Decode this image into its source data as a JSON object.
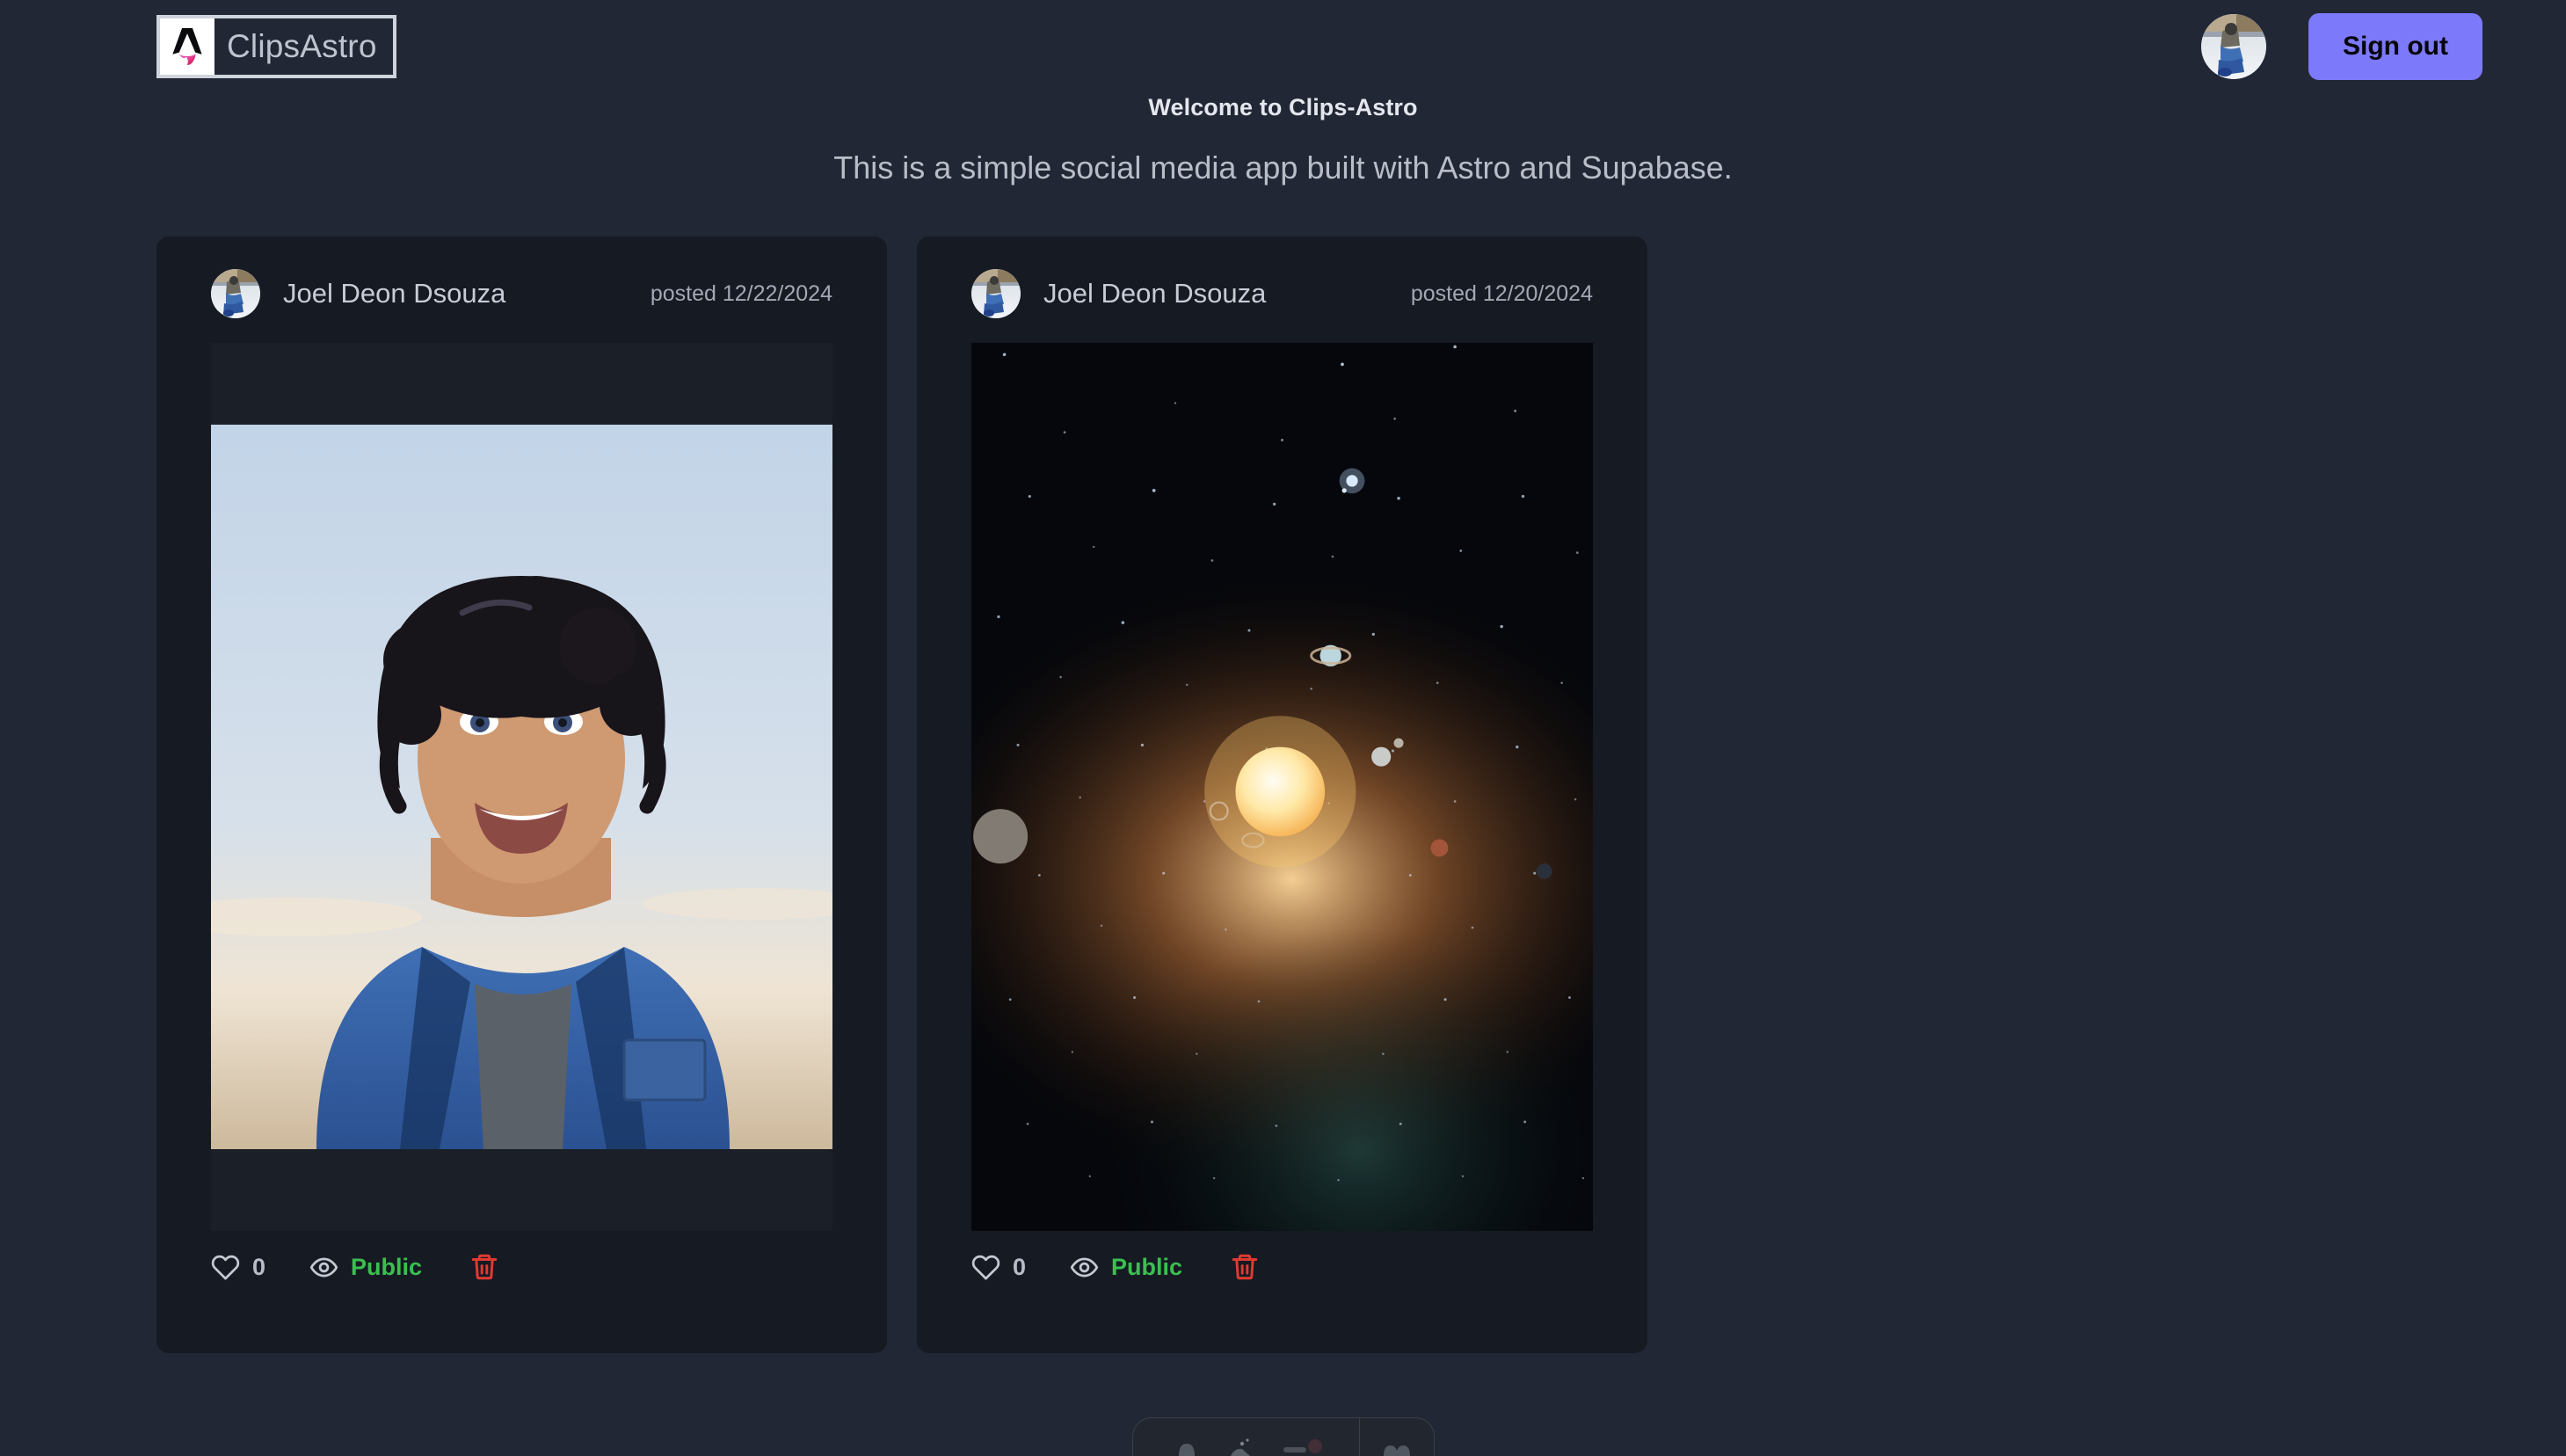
{
  "header": {
    "brand_name": "ClipsAstro",
    "brand_icon": "astro-logo-icon",
    "avatar_icon": "user-avatar",
    "signout_label": "Sign out"
  },
  "intro": {
    "title": "Welcome to Clips-Astro",
    "subtitle": "This is a simple social media app built with Astro and Supabase."
  },
  "colors": {
    "page_background": "#212734",
    "card_background": "#161a23",
    "accent_purple": "#7c79fa",
    "public_green": "#3bbf4f",
    "delete_red": "#e03a30",
    "muted_text": "#a3a8b4"
  },
  "posts": [
    {
      "author": "Joel Deon Dsouza",
      "date": "posted 12/22/2024",
      "image_alt": "anime-style portrait of a smiling man with curly dark hair in a blue shirt",
      "like_icon": "heart-icon",
      "like_count": "0",
      "visibility_icon": "eye-icon",
      "visibility": "Public",
      "delete_icon": "trash-icon"
    },
    {
      "author": "Joel Deon Dsouza",
      "date": "posted 12/20/2024",
      "image_alt": "space scene with a bright sun, orbiting planets and a starfield",
      "like_icon": "heart-icon",
      "like_count": "0",
      "visibility_icon": "eye-icon",
      "visibility": "Public",
      "delete_icon": "trash-icon"
    }
  ],
  "dock": {
    "icons": [
      "dock-app-icon",
      "dock-app-icon-2",
      "dock-app-icon-3",
      "dock-app-icon-4"
    ]
  }
}
